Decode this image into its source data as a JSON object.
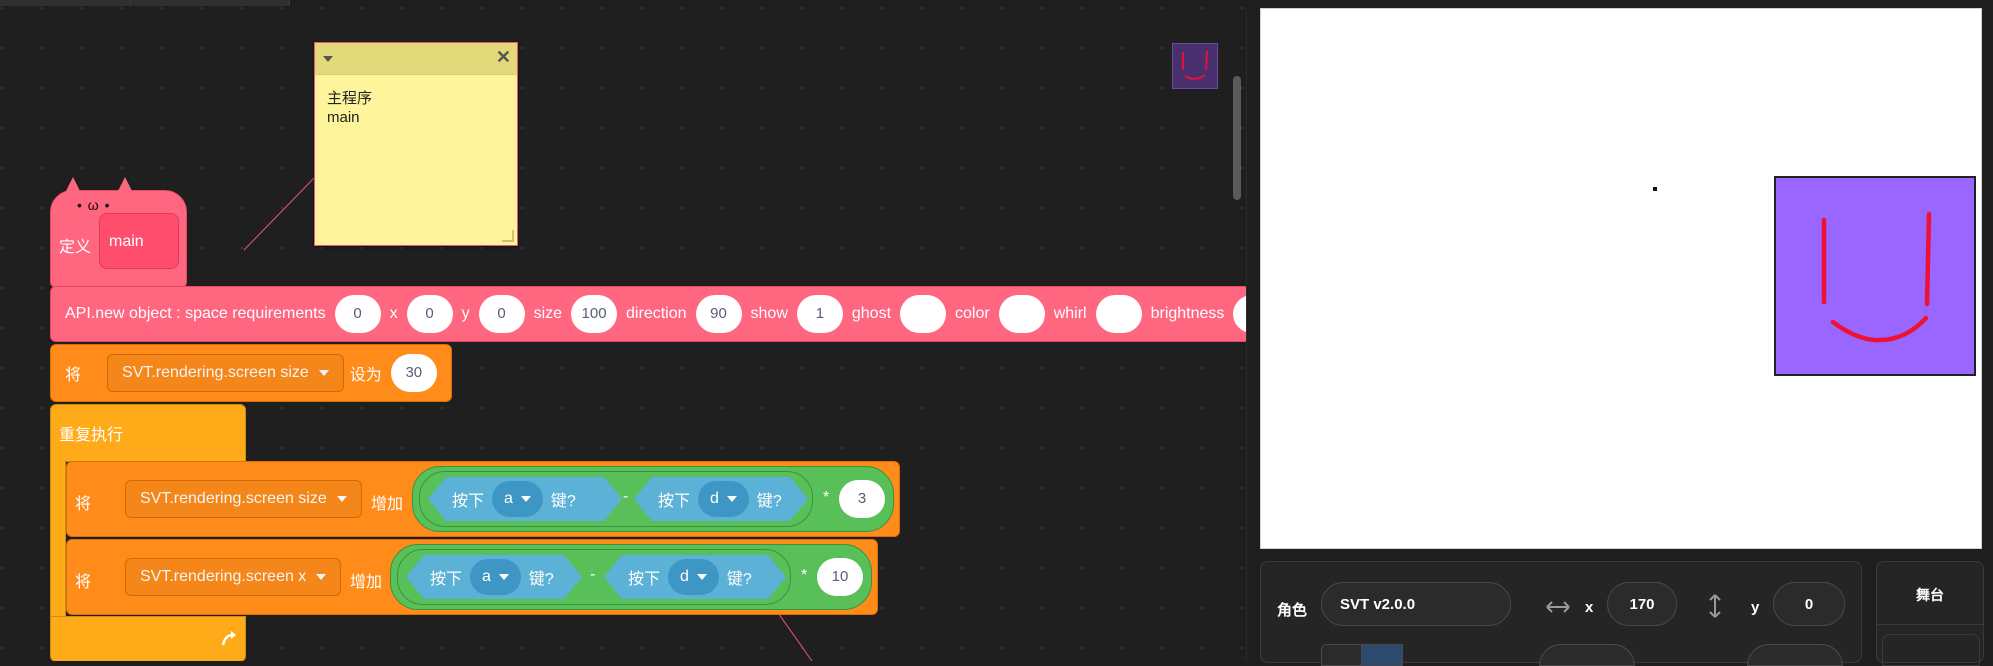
{
  "comment": {
    "line1": "主程序",
    "line2": "main"
  },
  "hat": {
    "label": "定义",
    "name": "main",
    "face": "• ω •"
  },
  "api_block": {
    "label": "API.new object : space requirements",
    "fields": [
      {
        "label": "",
        "value": "0"
      },
      {
        "label": "x",
        "value": "0"
      },
      {
        "label": "y",
        "value": "0"
      },
      {
        "label": "size",
        "value": "100"
      },
      {
        "label": "direction",
        "value": "90"
      },
      {
        "label": "show",
        "value": "1"
      },
      {
        "label": "ghost",
        "value": ""
      },
      {
        "label": "color",
        "value": ""
      },
      {
        "label": "whirl",
        "value": ""
      },
      {
        "label": "brightness",
        "value": ""
      }
    ]
  },
  "set_block": {
    "prefix": "将",
    "variable": "SVT.rendering.screen size",
    "verb": "设为",
    "value": "30"
  },
  "forever_block": {
    "label": "重复执行"
  },
  "change_size_block": {
    "prefix": "将",
    "variable": "SVT.rendering.screen size",
    "verb": "增加",
    "left": {
      "pre": "按下",
      "key": "a",
      "post": "键?"
    },
    "op": "-",
    "right": {
      "pre": "按下",
      "key": "d",
      "post": "键?"
    },
    "mult": "*",
    "factor": "3"
  },
  "change_x_block": {
    "prefix": "将",
    "variable": "SVT.rendering.screen x",
    "verb": "增加",
    "left": {
      "pre": "按下",
      "key": "a",
      "post": "键?"
    },
    "op": "-",
    "right": {
      "pre": "按下",
      "key": "d",
      "post": "键?"
    },
    "mult": "*",
    "factor": "10"
  },
  "sprite_info": {
    "sprite_label": "角色",
    "sprite_name": "SVT v2.0.0",
    "x_label": "x",
    "x_value": "170",
    "y_label": "y",
    "y_value": "0"
  },
  "stage_panel": {
    "label": "舞台"
  },
  "colors": {
    "event_pink": "#ff6680",
    "variable_orange": "#ff8c1a",
    "control_gold": "#ffab19",
    "operator_green": "#59c059",
    "sensing_blue": "#5cb1d6",
    "sprite_purple": "#9966ff"
  }
}
